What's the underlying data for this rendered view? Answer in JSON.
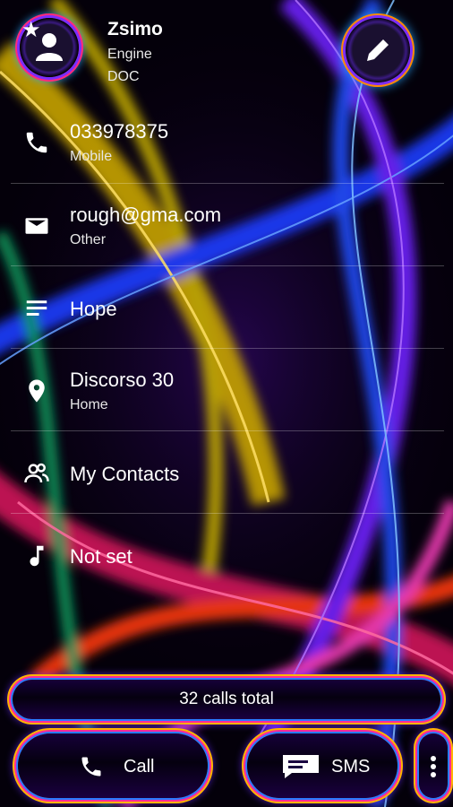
{
  "contact": {
    "name": "Zsimo",
    "line1": "Engine",
    "line2": "DOC"
  },
  "rows": [
    {
      "value": "033978375",
      "label": "Mobile",
      "icon": "phone-icon"
    },
    {
      "value": "rough@gma.com",
      "label": "Other",
      "icon": "email-icon"
    },
    {
      "value": "Hope",
      "label": "",
      "icon": "notes-icon"
    },
    {
      "value": "Discorso 30",
      "label": "Home",
      "icon": "location-icon"
    },
    {
      "value": "My Contacts",
      "label": "",
      "icon": "group-icon"
    },
    {
      "value": "Not set",
      "label": "",
      "icon": "ringtone-icon"
    }
  ],
  "footer": {
    "calls_total": "32 calls total",
    "call_label": "Call",
    "sms_label": "SMS"
  },
  "colors": {
    "accent_blue": "#2a7bff",
    "accent_pink": "#ff2a9a",
    "accent_yellow": "#ffb400",
    "accent_purple": "#7b2dff"
  }
}
